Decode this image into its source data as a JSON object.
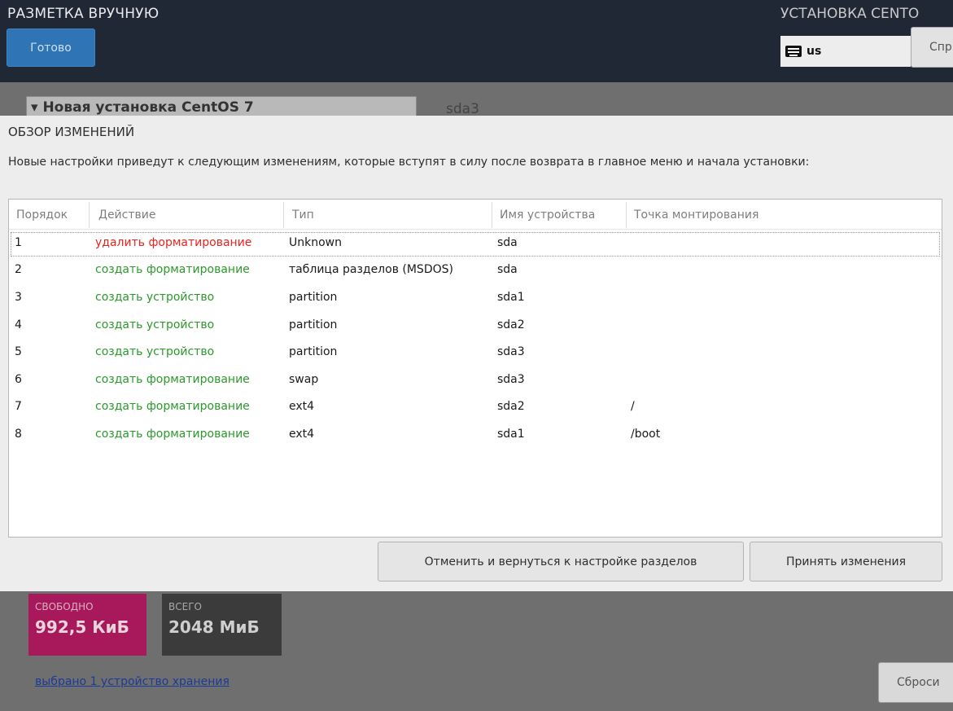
{
  "header": {
    "title": "РАЗМЕТКА ВРУЧНУЮ",
    "done_label": "Готово",
    "install_title": "УСТАНОВКА CENTO",
    "keyboard_layout": "us",
    "help_label": "Спр"
  },
  "background": {
    "dropdown_label": "▾ Новая установка CentOS 7",
    "device_label": "sda3"
  },
  "dialog": {
    "title": "ОБЗОР ИЗМЕНЕНИЙ",
    "description": "Новые настройки приведут к следующим изменениям, которые вступят в силу после возврата в главное меню и начала установки:",
    "columns": [
      "Порядок",
      "Действие",
      "Тип",
      "Имя устройства",
      "Точка монтирования"
    ],
    "rows": [
      {
        "order": "1",
        "action": "удалить форматирование",
        "type": "Unknown",
        "device": "sda",
        "mount": ""
      },
      {
        "order": "2",
        "action": "создать форматирование",
        "type": "таблица разделов (MSDOS)",
        "device": "sda",
        "mount": ""
      },
      {
        "order": "3",
        "action": "создать устройство",
        "type": "partition",
        "device": "sda1",
        "mount": ""
      },
      {
        "order": "4",
        "action": "создать устройство",
        "type": "partition",
        "device": "sda2",
        "mount": ""
      },
      {
        "order": "5",
        "action": "создать устройство",
        "type": "partition",
        "device": "sda3",
        "mount": ""
      },
      {
        "order": "6",
        "action": "создать форматирование",
        "type": "swap",
        "device": "sda3",
        "mount": ""
      },
      {
        "order": "7",
        "action": "создать форматирование",
        "type": "ext4",
        "device": "sda2",
        "mount": "/"
      },
      {
        "order": "8",
        "action": "создать форматирование",
        "type": "ext4",
        "device": "sda1",
        "mount": "/boot"
      }
    ],
    "cancel_label": "Отменить и вернуться к настройке разделов",
    "accept_label": "Принять изменения"
  },
  "storage": {
    "free_label": "СВОБОДНО",
    "free_value": "992,5 КиБ",
    "total_label": "ВСЕГО",
    "total_value": "2048 МиБ",
    "selected_link": "выбрано 1 устройство хранения",
    "reset_label": "Сброси"
  },
  "colors": {
    "header_bg": "#1f2834",
    "accent_blue": "#2f74b5",
    "delete_red": "#e8251f",
    "create_green": "#2b9a2b",
    "free_magenta": "#a7195b"
  }
}
